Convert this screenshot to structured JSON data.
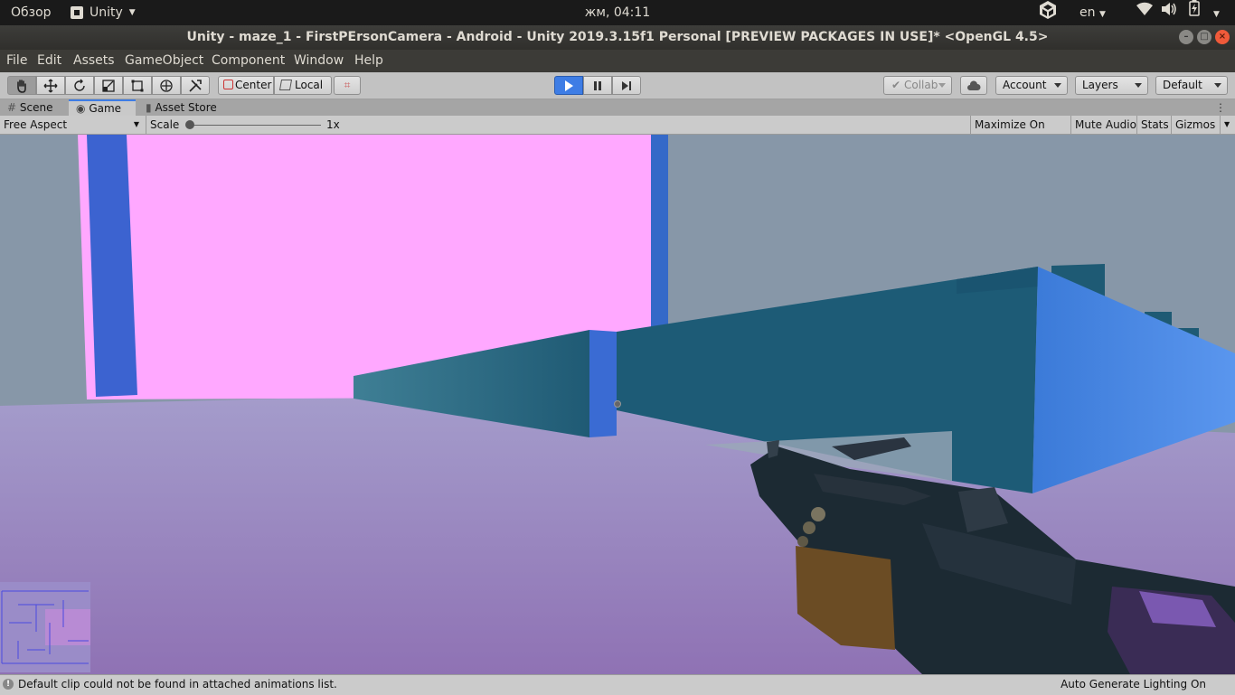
{
  "top_panel": {
    "activities": "Обзор",
    "app_name": "Unity",
    "clock": "жм, 04:11",
    "language": "en"
  },
  "titlebar": {
    "title": "Unity - maze_1 - FirstPErsonCamera - Android - Unity 2019.3.15f1 Personal [PREVIEW PACKAGES IN USE]* <OpenGL 4.5>"
  },
  "menubar": {
    "items": [
      "File",
      "Edit",
      "Assets",
      "GameObject",
      "Component",
      "Window",
      "Help"
    ]
  },
  "toolbar": {
    "pivot_mode": "Center",
    "pivot_rotation": "Local",
    "collab": "Collab",
    "account": "Account",
    "layers": "Layers",
    "layout": "Default",
    "play_active": true,
    "active_tool": "hand"
  },
  "tabs": [
    {
      "label": "Scene",
      "icon": "grid-icon"
    },
    {
      "label": "Game",
      "icon": "gamepad-icon",
      "active": true
    },
    {
      "label": "Asset Store",
      "icon": "store-icon"
    }
  ],
  "gamebar": {
    "aspect": "Free Aspect",
    "scale_label": "Scale",
    "scale_value": "1x",
    "maximize_on_play": "Maximize On Play",
    "mute_audio": "Mute Audio",
    "stats": "Stats",
    "gizmos": "Gizmos"
  },
  "statusbar": {
    "message": "Default clip could not be found in attached animations list.",
    "right": "Auto Generate Lighting On"
  },
  "colors": {
    "panel_bg": "#1a1a1a",
    "title_bg": "#302f2c",
    "menu_bg": "#3c3b37",
    "editor_bg": "#c2c2c2",
    "accent": "#3e7de5",
    "sky": "#8a97a8",
    "floor": "#9a86c0",
    "pink_wall": "#ffa8ff",
    "teal_wall": "#1f5d78",
    "blue_wall": "#3b6bd0"
  }
}
